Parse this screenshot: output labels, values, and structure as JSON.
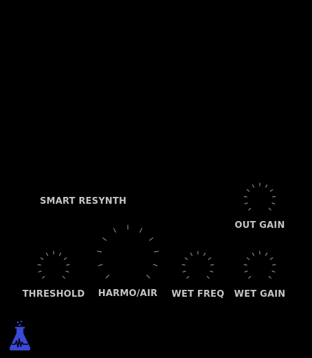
{
  "plugin": {
    "section_title": "SMART RESYNTH"
  },
  "knobs": [
    {
      "id": "out-gain",
      "label": "OUT GAIN"
    },
    {
      "id": "threshold",
      "label": "THRESHOLD"
    },
    {
      "id": "harmo-air",
      "label": "HARMO/AIR"
    },
    {
      "id": "wet-freq",
      "label": "WET FREQ"
    },
    {
      "id": "wet-gain",
      "label": "WET GAIN"
    }
  ],
  "colors": {
    "background": "#000000",
    "label": "#c4c4c4",
    "tick": "#8a8a8a",
    "logo": "#3a49d6"
  },
  "icons": {
    "logo": "lab-flask-icon"
  }
}
